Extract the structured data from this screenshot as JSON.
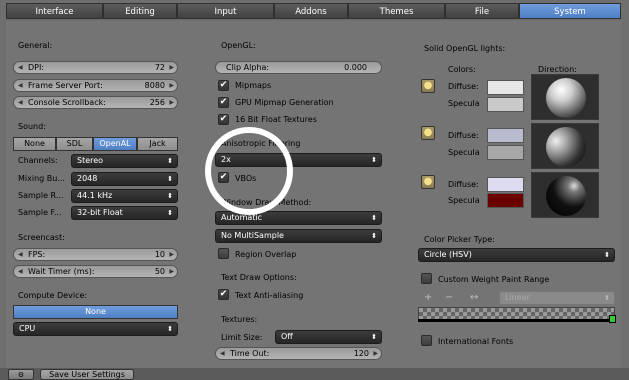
{
  "tabs": [
    {
      "label": "Interface"
    },
    {
      "label": "Editing"
    },
    {
      "label": "Input"
    },
    {
      "label": "Addons"
    },
    {
      "label": "Themes"
    },
    {
      "label": "File"
    },
    {
      "label": "System",
      "active": true
    }
  ],
  "general": {
    "heading": "General:",
    "dpi": {
      "label": "DPI:",
      "value": "72"
    },
    "frame_server_port": {
      "label": "Frame Server Port:",
      "value": "8080"
    },
    "console_scrollback": {
      "label": "Console Scrollback:",
      "value": "256"
    }
  },
  "sound": {
    "heading": "Sound:",
    "options": [
      "None",
      "SDL",
      "OpenAL",
      "Jack"
    ],
    "selected": "OpenAL",
    "channels": {
      "label": "Channels:",
      "value": "Stereo"
    },
    "mixing_buffer": {
      "label": "Mixing Bu...",
      "value": "2048"
    },
    "sample_rate": {
      "label": "Sample R...",
      "value": "44.1 kHz"
    },
    "sample_format": {
      "label": "Sample F...",
      "value": "32-bit Float"
    }
  },
  "screencast": {
    "heading": "Screencast:",
    "fps": {
      "label": "FPS:",
      "value": "10"
    },
    "wait_timer": {
      "label": "Wait Timer (ms):",
      "value": "50"
    }
  },
  "compute_device": {
    "heading": "Compute Device:",
    "type": "None",
    "device": "CPU"
  },
  "opengl": {
    "heading": "OpenGL:",
    "clip_alpha": {
      "label": "Clip Alpha:",
      "value": "0.000"
    },
    "mipmaps": "Mipmaps",
    "gpu_mipmap": "GPU Mipmap Generation",
    "float_textures": "16 Bit Float Textures",
    "anisotropic_label": "Anisotropic Filtering",
    "anisotropic_value": "2x",
    "vbos": "VBOs",
    "window_draw_label": "Window Draw Method:",
    "window_draw_value": "Automatic",
    "multisample_value": "No MultiSample",
    "region_overlap": "Region Overlap"
  },
  "text_draw": {
    "heading": "Text Draw Options:",
    "anti_aliasing": "Text Anti-aliasing"
  },
  "textures": {
    "heading": "Textures:",
    "limit_size": {
      "label": "Limit Size:",
      "value": "Off"
    },
    "time_out": {
      "label": "Time Out:",
      "value": "120"
    }
  },
  "lights": {
    "heading": "Solid OpenGL lights:",
    "colors_label": "Colors:",
    "direction_label": "Direction:",
    "diffuse_label": "Diffuse:",
    "specular_label": "Specula",
    "items": [
      {
        "diffuse_color": "#e6e6e6",
        "specular_color": "#c9c9c9"
      },
      {
        "diffuse_color": "#b9bccf",
        "specular_color": "#a7a7a7"
      },
      {
        "diffuse_color": "#dcdcf0",
        "specular_color": "#6a0000"
      }
    ]
  },
  "color_picker": {
    "heading": "Color Picker Type:",
    "value": "Circle (HSV)"
  },
  "weight_paint": {
    "label": "Custom Weight Paint Range",
    "interpolation": "Linear",
    "plus": "+",
    "minus": "−",
    "arrows": "↔"
  },
  "international_fonts": "International Fonts",
  "footer": {
    "save_button": "Save User Settings"
  }
}
